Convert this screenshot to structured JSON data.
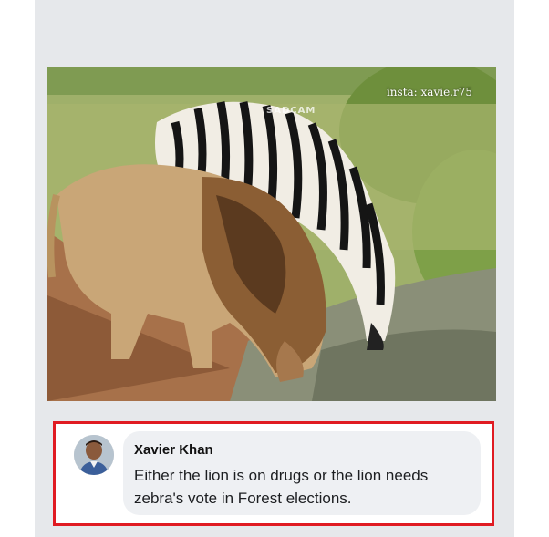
{
  "photo": {
    "watermark": "insta: xavie.r75",
    "stamp": "SADCAM",
    "description_icon": "lion-zebra-photo"
  },
  "comment": {
    "author": "Xavier Khan",
    "text": "Either the lion is on drugs or the lion needs zebra's vote in Forest elections.",
    "avatar_icon": "user-avatar-icon"
  },
  "colors": {
    "highlight_border": "#e01b22",
    "bubble_bg": "#eef0f3"
  }
}
